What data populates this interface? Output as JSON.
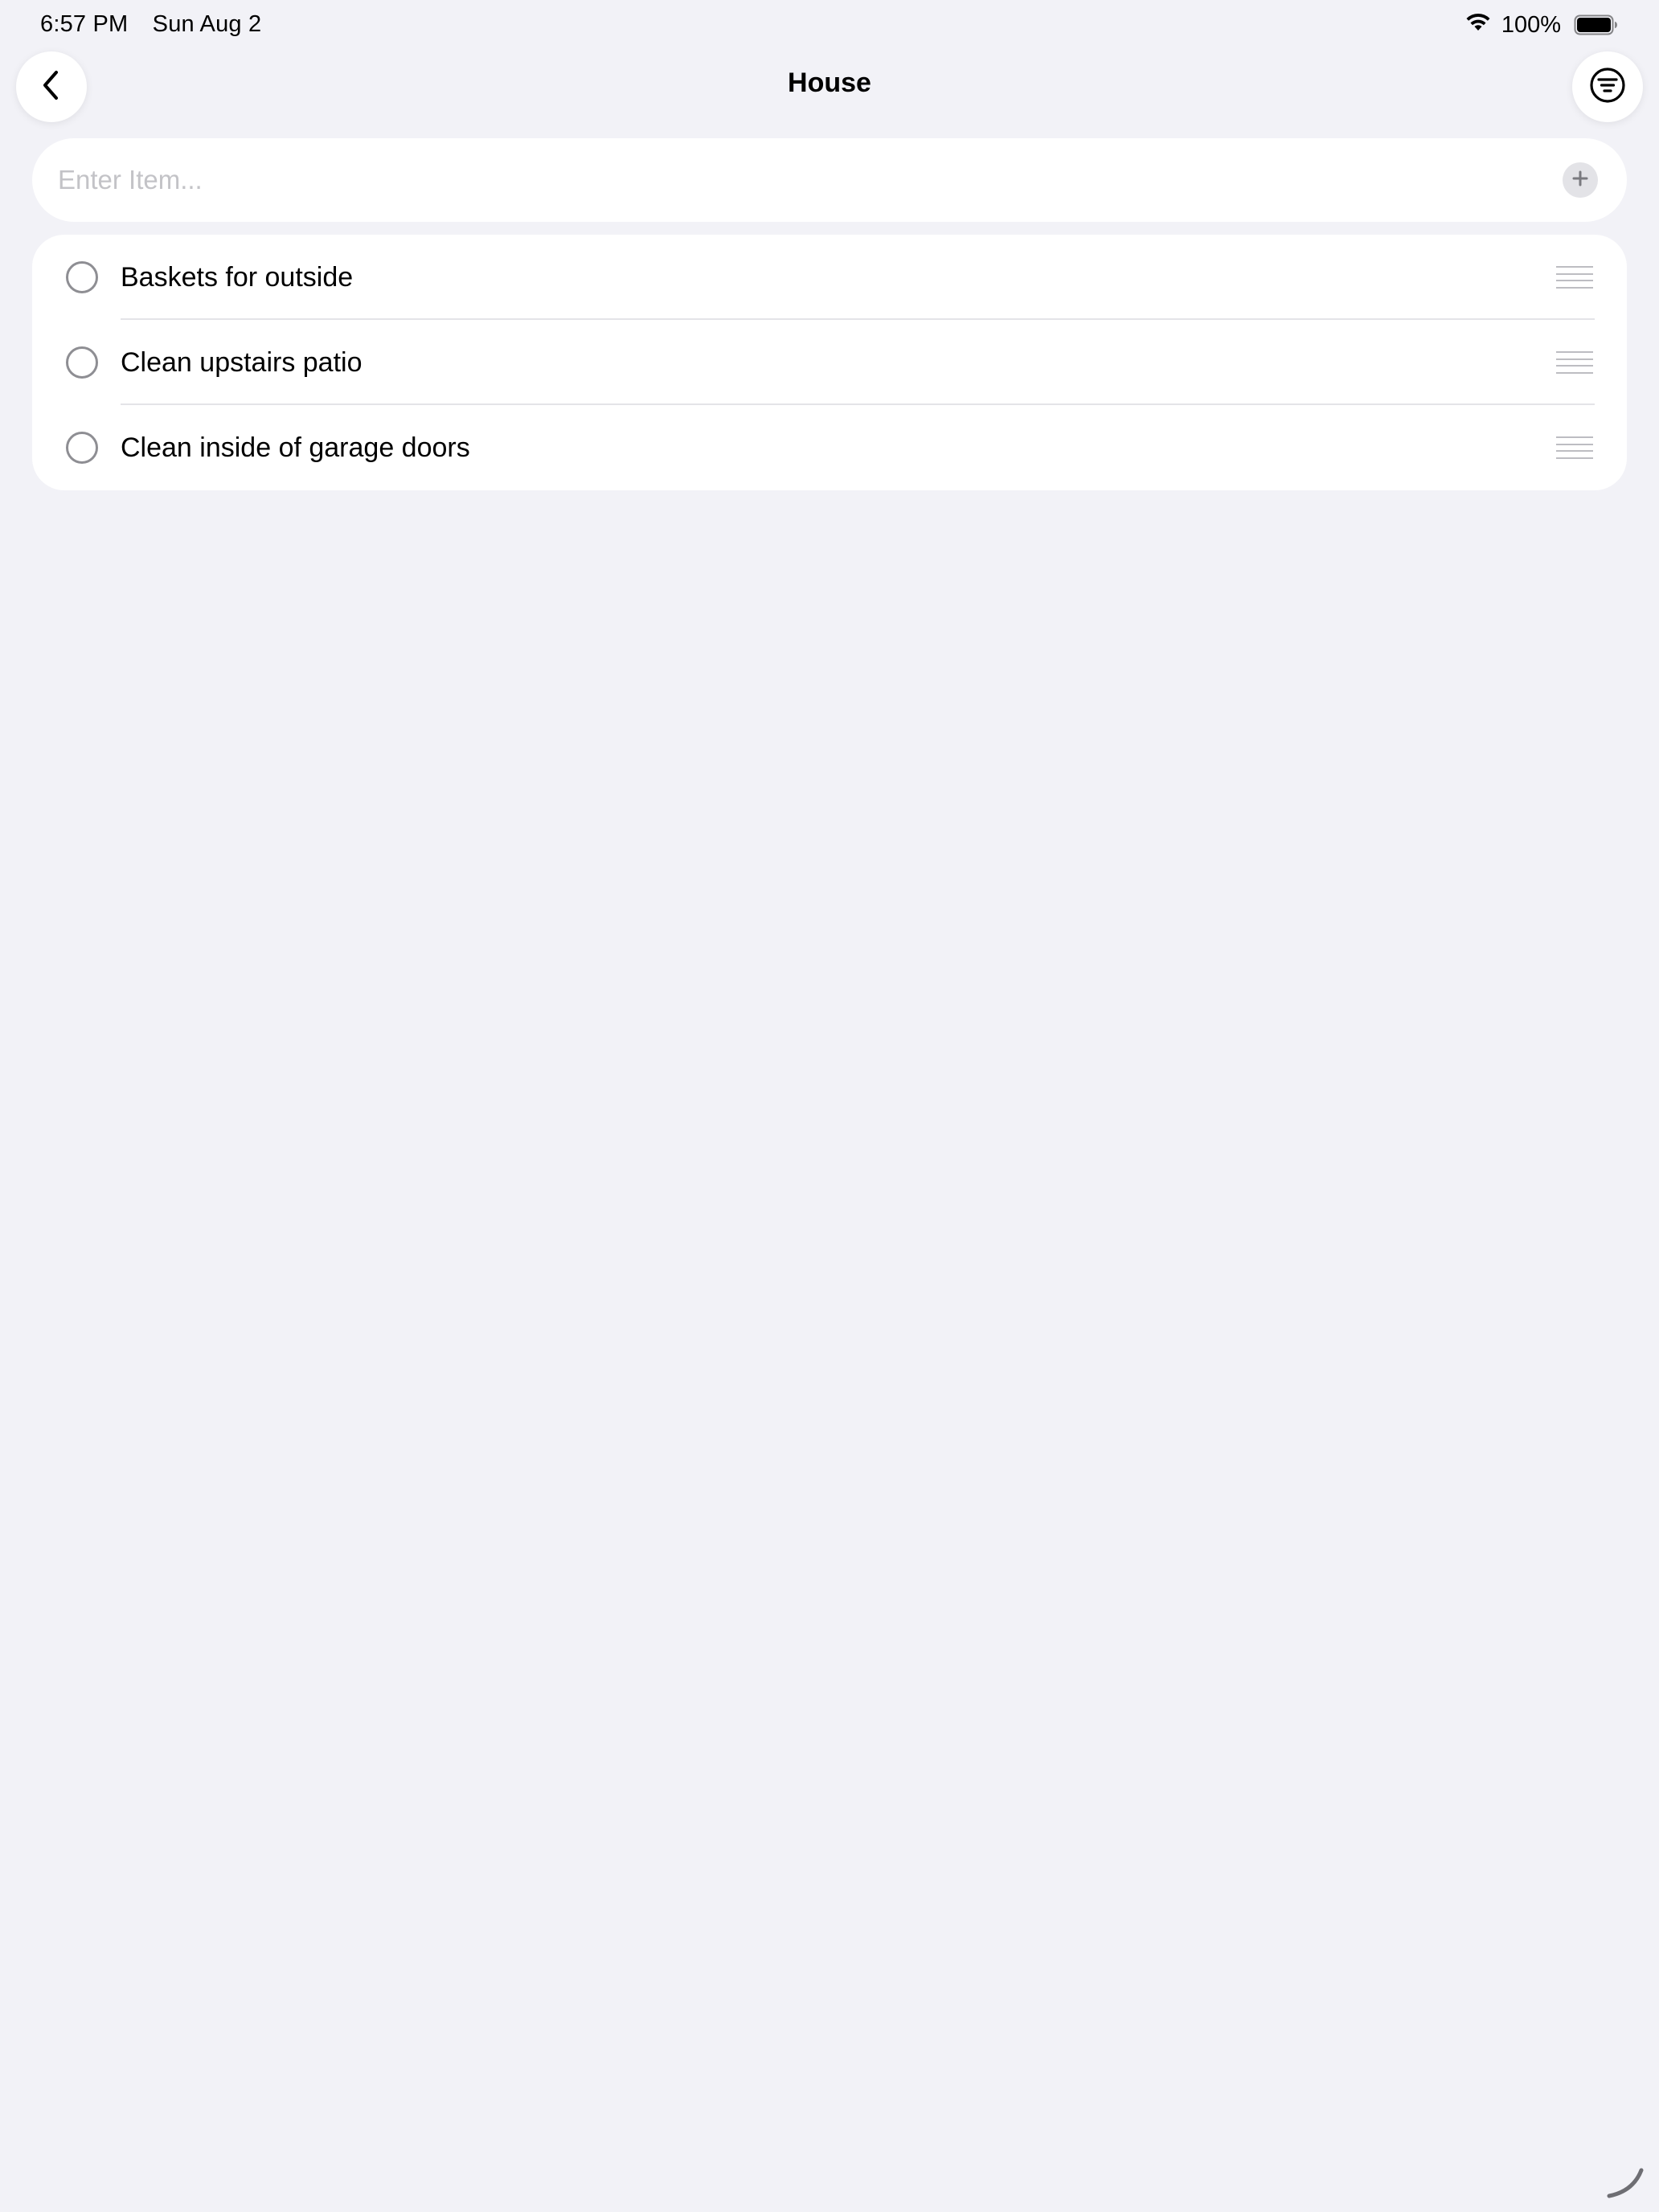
{
  "status_bar": {
    "time": "6:57 PM",
    "date": "Sun Aug 2",
    "wifi_icon": "wifi-icon",
    "battery_percent": "100%",
    "battery_level": 1.0
  },
  "nav": {
    "title": "House",
    "back_icon": "chevron-left-icon",
    "filter_icon": "filter-circle-icon"
  },
  "entry": {
    "placeholder": "Enter Item...",
    "value": "",
    "add_icon": "plus-icon"
  },
  "items": [
    {
      "label": "Baskets for outside",
      "checked": false
    },
    {
      "label": "Clean upstairs patio",
      "checked": false
    },
    {
      "label": "Clean inside of garage doors",
      "checked": false
    }
  ],
  "colors": {
    "background": "#f2f2f7",
    "card": "#ffffff",
    "checkbox_border": "#8e8e93",
    "placeholder": "#c3c3c7",
    "separator": "#e4e4e8"
  }
}
